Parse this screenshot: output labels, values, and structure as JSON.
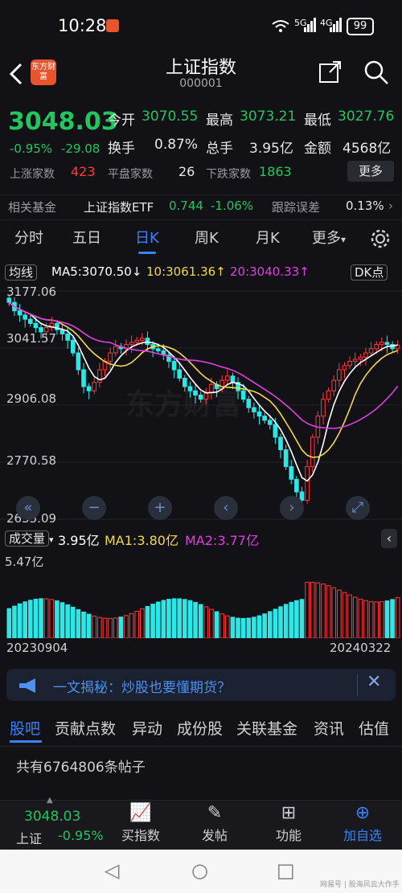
{
  "status_bar": {
    "time": "10:28",
    "signal1": "5G",
    "signal2": "4G",
    "battery": "99"
  },
  "header": {
    "title": "上证指数",
    "code": "000001",
    "logo_text": "东方财富"
  },
  "quote": {
    "price": "3048.03",
    "change_pct": "-0.95%",
    "change_amt": "-29.08",
    "open_label": "今开",
    "open": "3070.55",
    "high_label": "最高",
    "high": "3073.21",
    "low_label": "最低",
    "low": "3027.76",
    "turnover_rate_label": "换手",
    "turnover_rate": "0.87%",
    "volume_label": "总手",
    "volume": "3.95亿",
    "amount_label": "金额",
    "amount": "4568亿",
    "up_label": "上涨家数",
    "up_count": "423",
    "flat_label": "平盘家数",
    "flat_count": "26",
    "down_label": "下跌家数",
    "down_count": "1863",
    "more_label": "更多"
  },
  "fund_row": {
    "label": "相关基金",
    "etf_name": "上证指数ETF",
    "etf_price": "0.744",
    "etf_change": "-1.06%",
    "track_label": "跟踪误差",
    "track_value": "0.13%"
  },
  "tabs": [
    "分时",
    "五日",
    "日K",
    "周K",
    "月K",
    "更多"
  ],
  "active_tab": "日K",
  "kline": {
    "legend_label": "均线",
    "ma5": "MA5:3070.50↓",
    "ma10": "10:3061.36↑",
    "ma20": "20:3040.33↑",
    "dk_label": "DK点",
    "watermark": "东方财富",
    "y_ticks": [
      "3177.06",
      "3041.57",
      "2906.08",
      "2770.58",
      "2635.09"
    ]
  },
  "volume": {
    "label": "成交量",
    "value": "3.95亿",
    "ma1": "MA1:3.80亿",
    "ma2": "MA2:3.77亿",
    "max_tick": "5.47亿"
  },
  "dates": {
    "start": "20230904",
    "end": "20240322"
  },
  "banner": {
    "text": "一文揭秘：炒股也要懂期货？"
  },
  "news_tabs": [
    "股吧",
    "贡献点数",
    "异动",
    "成份股",
    "关联基金",
    "资讯",
    "估值"
  ],
  "posts_text": "共有6764806条帖子",
  "bottom_nav": {
    "mini_price": "3048.03",
    "mini_name": "上证",
    "mini_change": "-0.95%",
    "items": [
      "买指数",
      "发帖",
      "功能",
      "加自选"
    ]
  },
  "watermark_corner": "网易号 | 股海风云大作手",
  "colors": {
    "up": "#ff3b3b",
    "down": "#22c55e",
    "accent": "#3b82f6",
    "ma5": "#ffffff",
    "ma10": "#f5d94a",
    "ma20": "#e040e0",
    "volume_down": "#2ee6e6"
  },
  "chart_data": {
    "type": "candlestick",
    "title": "",
    "xlabel": "",
    "ylabel": "",
    "ylim": [
      2635.09,
      3177.06
    ],
    "date_range": [
      "20230904",
      "20240322"
    ],
    "close_approx": [
      3150,
      3130,
      3120,
      3110,
      3100,
      3090,
      3080,
      3090,
      3100,
      3085,
      3075,
      3060,
      3030,
      2990,
      2950,
      2940,
      2960,
      2990,
      3010,
      3030,
      3045,
      3040,
      3050,
      3055,
      3060,
      3065,
      3050,
      3040,
      3035,
      3025,
      3010,
      2990,
      2970,
      2950,
      2940,
      2930,
      2920,
      2935,
      2955,
      2945,
      2965,
      2975,
      2960,
      2940,
      2920,
      2900,
      2890,
      2880,
      2870,
      2860,
      2830,
      2800,
      2760,
      2730,
      2700,
      2680,
      2760,
      2830,
      2880,
      2920,
      2940,
      2965,
      2990,
      3000,
      3010,
      3015,
      3020,
      3030,
      3040,
      3050,
      3055,
      3050,
      3040,
      3048
    ],
    "ma5_last": 3070.5,
    "ma10_last": 3061.36,
    "ma20_last": 3040.33,
    "volume_last": "3.95亿",
    "volume_max": "5.47亿"
  }
}
